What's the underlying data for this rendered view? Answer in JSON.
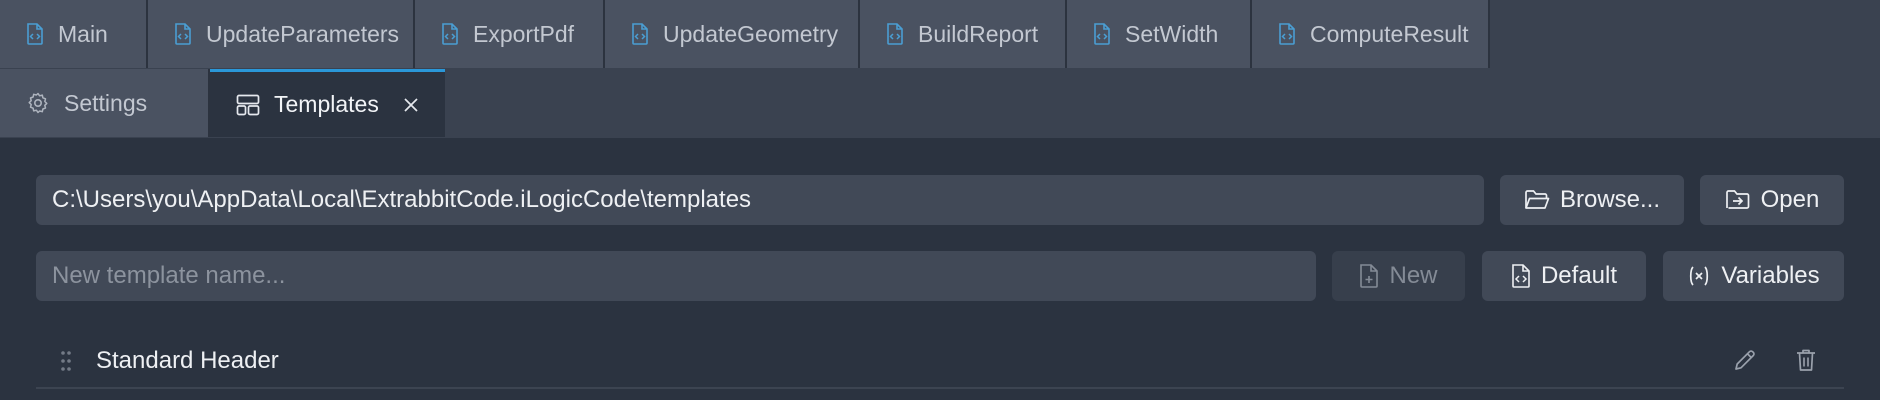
{
  "tabs_row1": [
    {
      "label": "Main",
      "icon": "code-file-icon"
    },
    {
      "label": "UpdateParameters",
      "icon": "code-file-icon"
    },
    {
      "label": "ExportPdf",
      "icon": "code-file-icon"
    },
    {
      "label": "UpdateGeometry",
      "icon": "code-file-icon"
    },
    {
      "label": "BuildReport",
      "icon": "code-file-icon"
    },
    {
      "label": "SetWidth",
      "icon": "code-file-icon"
    },
    {
      "label": "ComputeResult",
      "icon": "code-file-icon"
    }
  ],
  "tabs_row2": [
    {
      "label": "Settings",
      "icon": "gear-icon"
    },
    {
      "label": "Templates",
      "icon": "layout-icon",
      "active": true
    }
  ],
  "path_field": {
    "value": "C:\\Users\\you\\AppData\\Local\\ExtrabbitCode.iLogicCode\\templates"
  },
  "buttons": {
    "browse": "Browse...",
    "open": "Open",
    "new": "New",
    "default": "Default",
    "variables": "Variables"
  },
  "template_name_input": {
    "placeholder": "New template name..."
  },
  "templates": [
    {
      "name": "Standard Header"
    }
  ],
  "colors": {
    "accent": "#2a97d8",
    "background": "#2b3340",
    "tab_bg": "#4a5261"
  }
}
